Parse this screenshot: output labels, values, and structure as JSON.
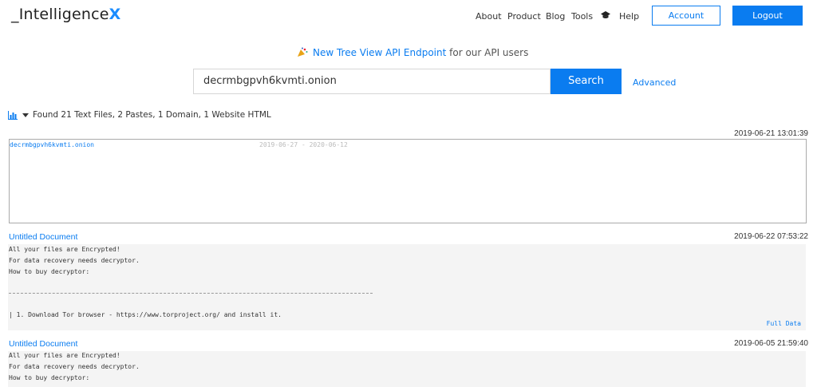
{
  "header": {
    "logo_main": "_Intelligence",
    "logo_x": "X",
    "nav": [
      "About",
      "Product",
      "Blog",
      "Tools",
      "Help"
    ],
    "account_label": "Account",
    "logout_label": "Logout",
    "accent": "#0a7cf0"
  },
  "announcement": {
    "link_text": "New Tree View API Endpoint",
    "rest_text": " for our API users"
  },
  "search": {
    "value": "decrmbgpvh6kvmti.onion",
    "button_label": "Search",
    "advanced_label": "Advanced"
  },
  "summary": {
    "text": "Found 21 Text Files, 2 Pastes, 1 Domain, 1 Website HTML"
  },
  "tree": {
    "timestamp": "2019-06-21 13:01:39",
    "item_name": "decrmbgpvh6kvmti.onion",
    "item_range": "2019-06-27 - 2020-06-12"
  },
  "results": [
    {
      "title": "Untitled Document",
      "timestamp": "2019-06-22 07:53:22",
      "lines": [
        "All your files are Encrypted!",
        "For data recovery needs decryptor.",
        "How to buy decryptor:",
        "| 1. Download Tor browser - https://www.torproject.org/ and install it."
      ],
      "full_data_label": "Full Data"
    },
    {
      "title": "Untitled Document",
      "timestamp": "2019-06-05 21:59:40",
      "lines": [
        "All your files are Encrypted!",
        "For data recovery needs decryptor.",
        "How to buy decryptor:"
      ]
    }
  ]
}
